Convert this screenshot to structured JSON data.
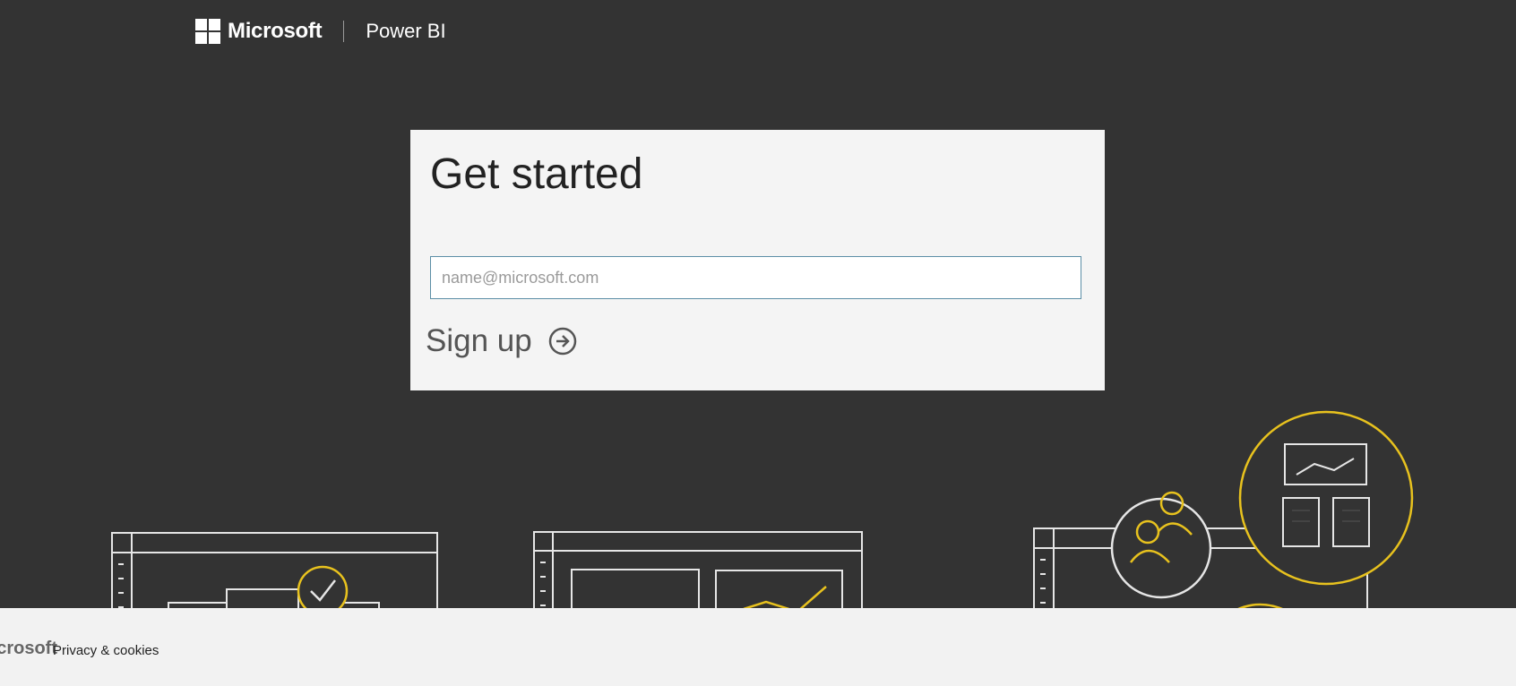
{
  "header": {
    "brand": "Microsoft",
    "product": "Power BI"
  },
  "card": {
    "title": "Get started",
    "email_value": "",
    "email_placeholder": "name@microsoft.com",
    "signup_label": "Sign up",
    "signup_icon": "circle-arrow-right-icon"
  },
  "footer": {
    "brand": "Microsoft",
    "privacy_link": "Privacy & cookies"
  },
  "colors": {
    "background": "#333333",
    "card": "#f4f4f4",
    "accent": "#e8c21e",
    "line": "#e6e6e6",
    "footer": "#f2f2f2"
  }
}
